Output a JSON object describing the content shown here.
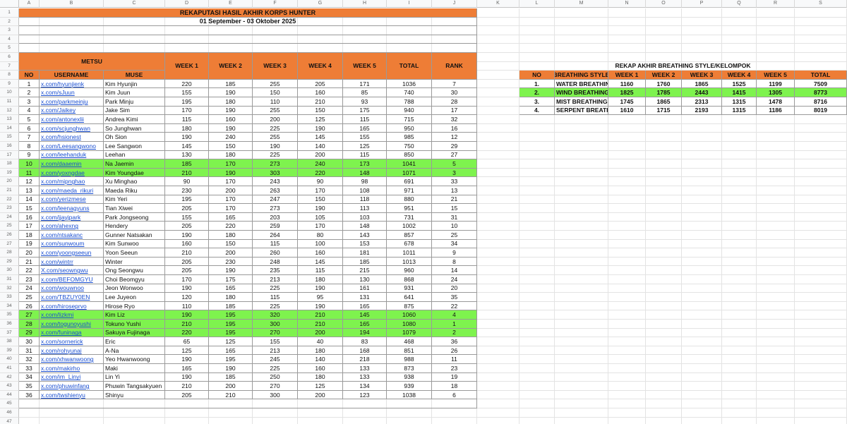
{
  "column_letters": [
    "A",
    "B",
    "C",
    "D",
    "E",
    "F",
    "G",
    "H",
    "I",
    "J",
    "K",
    "L",
    "M",
    "N",
    "O",
    "P",
    "Q",
    "R",
    "S"
  ],
  "title": "REKAPUTASI HASIL AKHIR KORPS HUNTER",
  "date_range": "01 September - 03 Oktober 2025",
  "group_label": "METSU",
  "headers": {
    "no": "NO",
    "username": "USERNAME",
    "muse": "MUSE",
    "weeks": [
      "WEEK 1",
      "WEEK 2",
      "WEEK 3",
      "WEEK 4",
      "WEEK 5"
    ],
    "total": "TOTAL",
    "rank": "RANK"
  },
  "rows": [
    {
      "no": "1",
      "username": "x.com/hyunjienk",
      "muse": "Kim Hyunjin",
      "w": [
        "220",
        "185",
        "255",
        "205",
        "171"
      ],
      "total": "1036",
      "rank": "7"
    },
    {
      "no": "2",
      "username": "x.com/sJuun",
      "muse": "Kim Juun",
      "w": [
        "155",
        "190",
        "150",
        "160",
        "85"
      ],
      "total": "740",
      "rank": "30"
    },
    {
      "no": "3",
      "username": "x.com/parkmeinju",
      "muse": "Park Minju",
      "w": [
        "195",
        "180",
        "110",
        "210",
        "93"
      ],
      "total": "788",
      "rank": "28"
    },
    {
      "no": "4",
      "username": "x.com/Jaikey",
      "muse": "Jake Sim",
      "w": [
        "170",
        "190",
        "255",
        "150",
        "175"
      ],
      "total": "940",
      "rank": "17"
    },
    {
      "no": "5",
      "username": "x.com/antonexlii",
      "muse": "Andrea Kimi",
      "w": [
        "115",
        "160",
        "200",
        "125",
        "115"
      ],
      "total": "715",
      "rank": "32"
    },
    {
      "no": "6",
      "username": "x.com/scjunghwan",
      "muse": "So Junghwan",
      "w": [
        "180",
        "190",
        "225",
        "190",
        "165"
      ],
      "total": "950",
      "rank": "16"
    },
    {
      "no": "7",
      "username": "x.com/hsionest",
      "muse": "Oh Sion",
      "w": [
        "190",
        "240",
        "255",
        "145",
        "155"
      ],
      "total": "985",
      "rank": "12"
    },
    {
      "no": "8",
      "username": "x.com/Leesangwono",
      "muse": "Lee Sangwon",
      "w": [
        "145",
        "150",
        "190",
        "140",
        "125"
      ],
      "total": "750",
      "rank": "29"
    },
    {
      "no": "9",
      "username": "x.com/leehanduk",
      "muse": "Leehan",
      "w": [
        "130",
        "180",
        "225",
        "200",
        "115"
      ],
      "total": "850",
      "rank": "27"
    },
    {
      "no": "10",
      "username": "x.com/daaemin",
      "muse": "Na Jaemin",
      "w": [
        "185",
        "170",
        "273",
        "240",
        "173"
      ],
      "total": "1041",
      "rank": "5",
      "hl": true
    },
    {
      "no": "11",
      "username": "x.com/yoxngdae",
      "muse": "Kim Youngdae",
      "w": [
        "210",
        "190",
        "303",
        "220",
        "148"
      ],
      "total": "1071",
      "rank": "3",
      "hl": true
    },
    {
      "no": "12",
      "username": "x.com/mipnghao",
      "muse": "Xu Minghao",
      "w": [
        "90",
        "170",
        "243",
        "90",
        "98"
      ],
      "total": "691",
      "rank": "33"
    },
    {
      "no": "13",
      "username": "x.com/maeda_rikuri",
      "muse": "Maeda Riku",
      "w": [
        "230",
        "200",
        "263",
        "170",
        "108"
      ],
      "total": "971",
      "rank": "13"
    },
    {
      "no": "14",
      "username": "x.com/yerizmese",
      "muse": "Kim Yeri",
      "w": [
        "195",
        "170",
        "247",
        "150",
        "118"
      ],
      "total": "880",
      "rank": "21"
    },
    {
      "no": "15",
      "username": "x.com/leenagyuns",
      "muse": "Tian Xiwei",
      "w": [
        "205",
        "170",
        "273",
        "190",
        "113"
      ],
      "total": "951",
      "rank": "15"
    },
    {
      "no": "16",
      "username": "x.com/jjayjpark",
      "muse": "Park Jongseong",
      "w": [
        "155",
        "165",
        "203",
        "105",
        "103"
      ],
      "total": "731",
      "rank": "31"
    },
    {
      "no": "17",
      "username": "x.com/ahexng",
      "muse": "Hendery",
      "w": [
        "205",
        "220",
        "259",
        "170",
        "148"
      ],
      "total": "1002",
      "rank": "10"
    },
    {
      "no": "18",
      "username": "x.com/ntsakanc",
      "muse": "Gunner Natsakan",
      "w": [
        "190",
        "180",
        "264",
        "80",
        "143"
      ],
      "total": "857",
      "rank": "25"
    },
    {
      "no": "19",
      "username": "x.com/sunwoum",
      "muse": "Kim Sunwoo",
      "w": [
        "160",
        "150",
        "115",
        "100",
        "153"
      ],
      "total": "678",
      "rank": "34"
    },
    {
      "no": "20",
      "username": "x.com/yoongseeun",
      "muse": "Yoon Seeun",
      "w": [
        "210",
        "200",
        "260",
        "160",
        "181"
      ],
      "total": "1011",
      "rank": "9"
    },
    {
      "no": "21",
      "username": "x.com/wintrr",
      "muse": "Winter",
      "w": [
        "205",
        "230",
        "248",
        "145",
        "185"
      ],
      "total": "1013",
      "rank": "8"
    },
    {
      "no": "22",
      "username": "X.com/seowngwu",
      "muse": "Ong Seongwu",
      "w": [
        "205",
        "190",
        "235",
        "115",
        "215"
      ],
      "total": "960",
      "rank": "14"
    },
    {
      "no": "23",
      "username": "x.com/BEFOMGYU",
      "muse": "Choi Beomgyu",
      "w": [
        "170",
        "175",
        "213",
        "180",
        "130"
      ],
      "total": "868",
      "rank": "24"
    },
    {
      "no": "24",
      "username": "x.com/wouwnoo",
      "muse": "Jeon Wonwoo",
      "w": [
        "190",
        "165",
        "225",
        "190",
        "161"
      ],
      "total": "931",
      "rank": "20"
    },
    {
      "no": "25",
      "username": "x.com/TBZUY0EN",
      "muse": "Lee Juyeon",
      "w": [
        "120",
        "180",
        "115",
        "95",
        "131"
      ],
      "total": "641",
      "rank": "35"
    },
    {
      "no": "26",
      "username": "x.com/hiroseprvo",
      "muse": "Hirose Ryo",
      "w": [
        "110",
        "185",
        "225",
        "190",
        "165"
      ],
      "total": "875",
      "rank": "22"
    },
    {
      "no": "27",
      "username": "x.com/lizkmi",
      "muse": "Kim Liz",
      "w": [
        "190",
        "195",
        "320",
        "210",
        "145"
      ],
      "total": "1060",
      "rank": "4",
      "hl": true
    },
    {
      "no": "28",
      "username": "x.com/togunoyushi",
      "muse": "Tokuno Yushi",
      "w": [
        "210",
        "195",
        "300",
        "210",
        "165"
      ],
      "total": "1080",
      "rank": "1",
      "hl": true
    },
    {
      "no": "29",
      "username": "x.com/funinaga",
      "muse": "Sakuya Fujinaga",
      "w": [
        "220",
        "195",
        "270",
        "200",
        "194"
      ],
      "total": "1079",
      "rank": "2",
      "hl": true
    },
    {
      "no": "30",
      "username": "x.com/sornerick",
      "muse": "Eric",
      "w": [
        "65",
        "125",
        "155",
        "40",
        "83"
      ],
      "total": "468",
      "rank": "36"
    },
    {
      "no": "31",
      "username": "x.com/rohyunai",
      "muse": "A-Na",
      "w": [
        "125",
        "165",
        "213",
        "180",
        "168"
      ],
      "total": "851",
      "rank": "26"
    },
    {
      "no": "32",
      "username": "x.com/xhwanwoong",
      "muse": "Yeo Hwanwoong",
      "w": [
        "190",
        "195",
        "245",
        "140",
        "218"
      ],
      "total": "988",
      "rank": "11"
    },
    {
      "no": "33",
      "username": "x.com/makirho",
      "muse": "Maki",
      "w": [
        "165",
        "190",
        "225",
        "160",
        "133"
      ],
      "total": "873",
      "rank": "23"
    },
    {
      "no": "34",
      "username": "x.com/im_Linyi",
      "muse": "Lin Yi",
      "w": [
        "190",
        "185",
        "250",
        "180",
        "133"
      ],
      "total": "938",
      "rank": "19"
    },
    {
      "no": "35",
      "username": "x.com/phuwinfang",
      "muse": "Phuwin Tangsakyuen",
      "w": [
        "210",
        "200",
        "270",
        "125",
        "134"
      ],
      "total": "939",
      "rank": "18"
    },
    {
      "no": "36",
      "username": "x.com/twshienyu",
      "muse": "Shinyu",
      "w": [
        "205",
        "210",
        "300",
        "200",
        "123"
      ],
      "total": "1038",
      "rank": "6"
    }
  ],
  "recap": {
    "title": "REKAP AKHIR BREATHING STYLE/KELOMPOK",
    "headers": [
      "NO",
      "BREATHING STYLE",
      "WEEK 1",
      "WEEK 2",
      "WEEK 3",
      "WEEK 4",
      "WEEK 5",
      "TOTAL"
    ],
    "rows": [
      {
        "no": "1.",
        "style": "WATER BREATHING",
        "w": [
          "1160",
          "1760",
          "1865",
          "1525",
          "1199"
        ],
        "total": "7509"
      },
      {
        "no": "2.",
        "style": "WIND BREATHING",
        "w": [
          "1825",
          "1785",
          "2443",
          "1415",
          "1305"
        ],
        "total": "8773",
        "hl": true
      },
      {
        "no": "3.",
        "style": "MIST BREATHING",
        "w": [
          "1745",
          "1865",
          "2313",
          "1315",
          "1478"
        ],
        "total": "8716"
      },
      {
        "no": "4.",
        "style": "SERPENT BREATHING",
        "w": [
          "1610",
          "1715",
          "2193",
          "1315",
          "1186"
        ],
        "total": "8019"
      }
    ]
  },
  "colors": {
    "header_orange": "#ee7d36",
    "highlight_green": "#7ef34e",
    "link_blue": "#1a4fd1"
  }
}
